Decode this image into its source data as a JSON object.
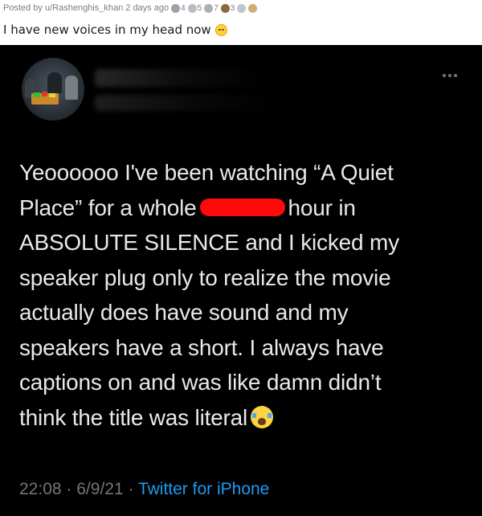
{
  "reddit": {
    "posted_by": "Posted by u/Rashenghis_khan 2 days ago",
    "awards": [
      {
        "icon": "award-icon",
        "count": "4",
        "color": "#9aa3ab"
      },
      {
        "icon": "award-icon",
        "count": "5",
        "color": "#b8bec4"
      },
      {
        "icon": "award-icon",
        "count": "7",
        "color": "#a9b0b6"
      },
      {
        "icon": "award-icon",
        "count": "3",
        "color": "#8a6a3a"
      },
      {
        "icon": "award-icon",
        "count": "",
        "color": "#c0c6cc"
      },
      {
        "icon": "award-icon",
        "count": "",
        "color": "#d0b070"
      }
    ],
    "title": "I have new voices in my head now"
  },
  "tweet": {
    "line1": "Yeoooooo I've been watching “A Quiet",
    "line2a": "Place” for a whole",
    "line2b": "hour in",
    "line3": "ABSOLUTE SILENCE and I kicked my",
    "line4": "speaker plug only to realize the movie",
    "line5": "actually does have sound and my",
    "line6": "speakers have a short. I always have",
    "line7": "captions on and was like damn didn’t",
    "line8": "think the title was literal",
    "time": "22:08",
    "date": "6/9/21",
    "separator": "·",
    "source": "Twitter for iPhone"
  },
  "colors": {
    "tweet_bg": "#000000",
    "tweet_text": "#e7e9ea",
    "muted": "#71767b",
    "link": "#1d9bf0",
    "redaction": "#ff0a0a"
  }
}
